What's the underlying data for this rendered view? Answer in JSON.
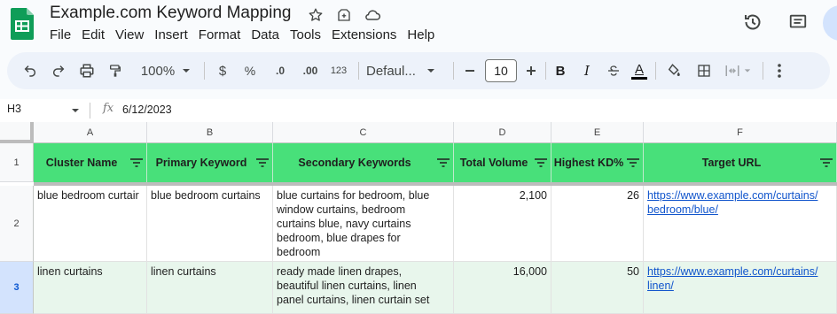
{
  "app": {
    "doc_title": "Example.com Keyword Mapping",
    "brand_color": "#0f9d58",
    "menu": [
      "File",
      "Edit",
      "View",
      "Insert",
      "Format",
      "Data",
      "Tools",
      "Extensions",
      "Help"
    ]
  },
  "toolbar": {
    "zoom": "100%",
    "currency": "$",
    "percent": "%",
    "decrease_decimal": ".0",
    "increase_decimal": ".00",
    "number_format": "123",
    "font_name": "Defaul...",
    "font_size": "10",
    "bold": "B",
    "italic": "I",
    "text_color_letter": "A"
  },
  "formula_bar": {
    "cell_ref": "H3",
    "fx": "fx",
    "value": "6/12/2023"
  },
  "grid": {
    "column_letters": [
      "A",
      "B",
      "C",
      "D",
      "E",
      "F"
    ],
    "row_numbers": [
      "1",
      "2",
      "3"
    ],
    "header_fill": "#48e07a",
    "headers": [
      "Cluster Name",
      "Primary Keyword",
      "Secondary Keywords",
      "Total Volume",
      "Highest KD%",
      "Target URL"
    ],
    "rows": [
      {
        "cluster": "blue bedroom curtair",
        "primary": "blue bedroom curtains",
        "secondary_lines": [
          "blue curtains for bedroom, blue",
          "window curtains, bedroom",
          "curtains blue, navy curtains",
          "bedroom, blue drapes for",
          "bedroom"
        ],
        "volume": "2,100",
        "kd": "26",
        "url_lines": [
          "https://www.example.com/curtains/",
          "bedroom/blue/"
        ]
      },
      {
        "cluster": "linen curtains",
        "primary": "linen curtains",
        "secondary_lines": [
          "ready made linen drapes,",
          "beautiful linen curtains, linen",
          "panel curtains, linen curtain set"
        ],
        "volume": "16,000",
        "kd": "50",
        "url_lines": [
          "https://www.example.com/curtains/",
          "linen/"
        ]
      }
    ]
  }
}
